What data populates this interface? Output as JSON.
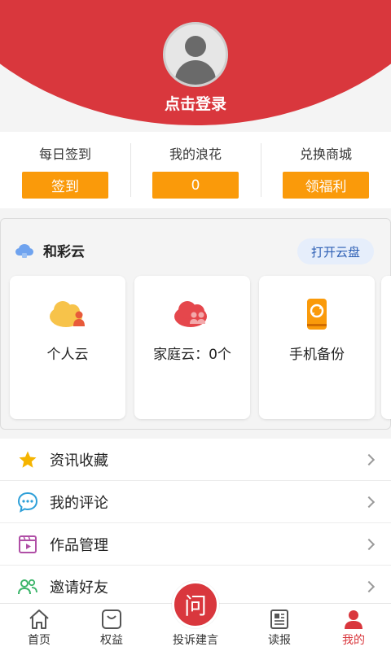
{
  "header": {
    "login_text": "点击登录",
    "bg_color": "#d9373d"
  },
  "stats": [
    {
      "label": "每日签到",
      "button": "签到"
    },
    {
      "label": "我的浪花",
      "button": "0"
    },
    {
      "label": "兑换商城",
      "button": "领福利"
    }
  ],
  "cloud": {
    "title": "和彩云",
    "open_button": "打开云盘",
    "tiles": [
      {
        "label": "个人云",
        "icon": "personal-cloud-icon"
      },
      {
        "label": "家庭云：0个",
        "icon": "family-cloud-icon"
      },
      {
        "label": "手机备份",
        "icon": "phone-backup-icon"
      }
    ]
  },
  "menu": [
    {
      "label": "资讯收藏",
      "icon": "star-icon"
    },
    {
      "label": "我的评论",
      "icon": "comment-icon"
    },
    {
      "label": "作品管理",
      "icon": "video-icon"
    },
    {
      "label": "邀请好友",
      "icon": "invite-friends-icon"
    }
  ],
  "nav": [
    {
      "label": "首页",
      "icon": "home-icon"
    },
    {
      "label": "权益",
      "icon": "shopping-bag-icon"
    },
    {
      "label": "投诉建言",
      "icon": "complaint-icon",
      "glyph": "问"
    },
    {
      "label": "读报",
      "icon": "newspaper-icon"
    },
    {
      "label": "我的",
      "icon": "profile-icon"
    }
  ],
  "colors": {
    "accent": "#d9373d",
    "orange": "#fa9a0a",
    "link_blue": "#2d5fb4"
  }
}
